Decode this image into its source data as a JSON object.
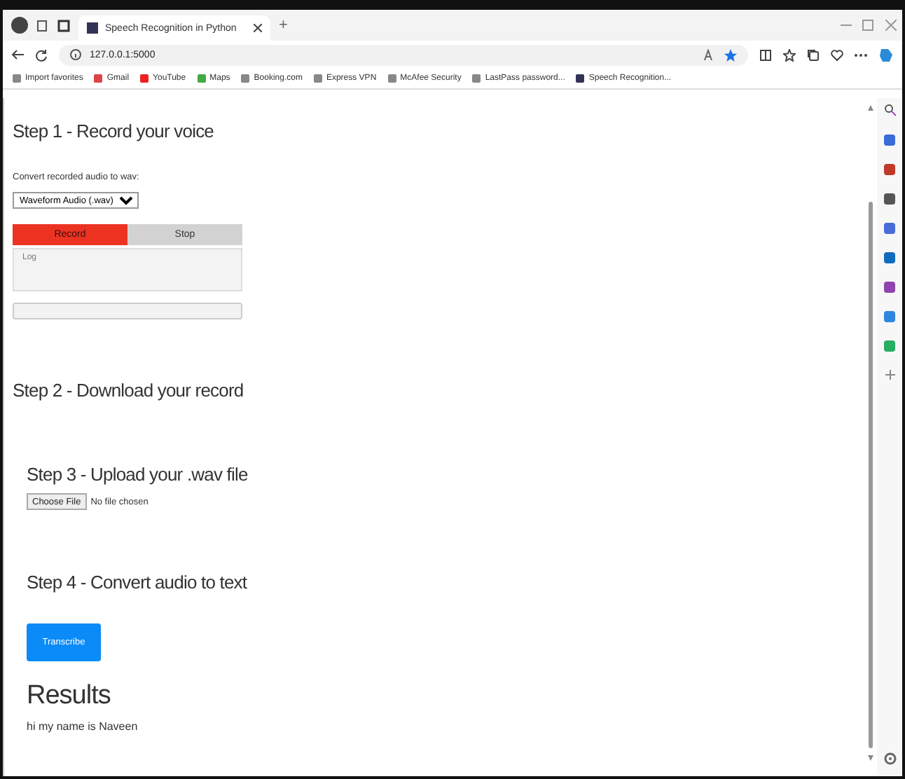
{
  "tab": {
    "title": "Speech Recognition in Python",
    "new_tab": "+"
  },
  "address_bar": {
    "url": "127.0.0.1:5000"
  },
  "bookmarks": [
    "Import favorites",
    "Gmail",
    "YouTube",
    "Maps",
    "Booking.com",
    "Express VPN",
    "McAfee Security",
    "LastPass password...",
    "Speech Recognition..."
  ],
  "step1": {
    "heading": "Step 1 - Record your voice",
    "convert_label": "Convert recorded audio to wav:",
    "format_select": "Waveform Audio (.wav)",
    "buttons": [
      {
        "label": "Record",
        "active": true
      },
      {
        "label": "Stop",
        "active": false
      }
    ],
    "log": {
      "placeholder": "Log"
    },
    "progress": {
      "level": 0
    }
  },
  "step2": {
    "heading": "Step 2 - Download your record"
  },
  "step3": {
    "heading": "Step 3 - Upload your .wav file",
    "file_button": "Choose File",
    "file_status": "No file chosen"
  },
  "step4": {
    "heading": "Step 4 - Convert audio to text",
    "button": "Transcribe"
  },
  "results": {
    "heading": "Results",
    "text": "hi my name is Naveen"
  }
}
